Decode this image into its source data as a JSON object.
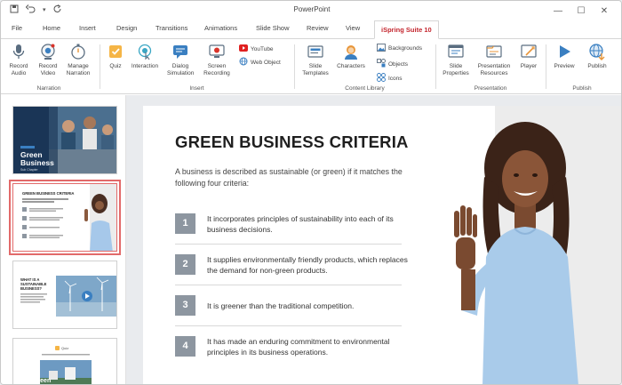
{
  "app": {
    "title": "PowerPoint",
    "quick_access": {
      "save_icon": "save-icon",
      "undo_icon": "undo-icon",
      "redo_icon": "redo-icon"
    },
    "window_controls": {
      "minimize": "—",
      "maximize": "☐",
      "close": "✕"
    }
  },
  "tabs": [
    {
      "label": "File"
    },
    {
      "label": "Home"
    },
    {
      "label": "Insert"
    },
    {
      "label": "Design"
    },
    {
      "label": "Transitions"
    },
    {
      "label": "Animations"
    },
    {
      "label": "Slide Show"
    },
    {
      "label": "Review"
    },
    {
      "label": "View"
    },
    {
      "label": "iSpring Suite 10",
      "active": true
    }
  ],
  "ribbon": {
    "narration": {
      "label": "Narration",
      "buttons": [
        {
          "label": "Record Audio"
        },
        {
          "label": "Record Video"
        },
        {
          "label": "Manage Narration"
        }
      ]
    },
    "insert": {
      "label": "Insert",
      "buttons": [
        {
          "label": "Quiz"
        },
        {
          "label": "Interaction"
        },
        {
          "label": "Dialog Simulation"
        },
        {
          "label": "Screen Recording"
        }
      ],
      "small": [
        {
          "label": "YouTube"
        },
        {
          "label": "Web Object"
        }
      ]
    },
    "content_library": {
      "label": "Content Library",
      "buttons": [
        {
          "label": "Slide Templates"
        },
        {
          "label": "Characters"
        }
      ],
      "small": [
        {
          "label": "Backgrounds"
        },
        {
          "label": "Objects"
        },
        {
          "label": "Icons"
        }
      ]
    },
    "presentation": {
      "label": "Presentation",
      "buttons": [
        {
          "label": "Slide Properties"
        },
        {
          "label": "Presentation Resources"
        },
        {
          "label": "Player"
        }
      ]
    },
    "publish": {
      "label": "Publish",
      "buttons": [
        {
          "label": "Preview"
        },
        {
          "label": "Publish"
        }
      ]
    }
  },
  "thumbnails": [
    {
      "title": "Green Business",
      "subtitle": "Sub Chapter"
    },
    {
      "title": "GREEN BUSINESS CRITERIA",
      "selected": true
    },
    {
      "title": "WHAT IS A SUSTAINABLE BUSINESS?"
    },
    {
      "badge": "Quiz",
      "title": "Green"
    }
  ],
  "slide": {
    "title": "GREEN BUSINESS CRITERIA",
    "intro": "A business is described as sustainable (or green) if it matches the following four criteria:",
    "criteria": [
      {
        "num": "1",
        "text": "It incorporates principles of sustainability into each of its business decisions."
      },
      {
        "num": "2",
        "text": "It supplies environmentally friendly products, which replaces the demand for non-green products."
      },
      {
        "num": "3",
        "text": "It is greener than the traditional competition."
      },
      {
        "num": "4",
        "text": "It has made an enduring commitment to environmental principles in its business operations."
      }
    ]
  },
  "colors": {
    "accent": "#c4262e",
    "number_box": "#8d96a0",
    "ribbon_icon_blue": "#3a7fc1",
    "ribbon_icon_orange": "#e8963a"
  }
}
